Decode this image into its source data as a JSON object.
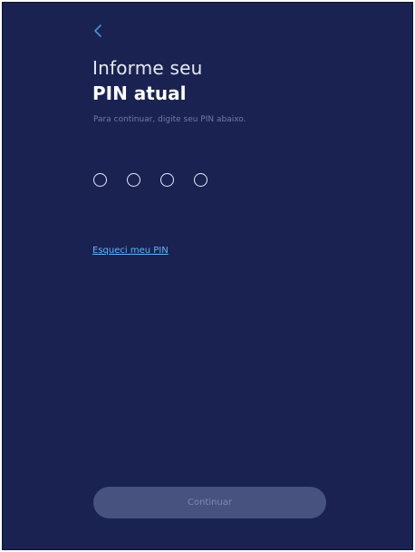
{
  "colors": {
    "background": "#1a2251",
    "accent": "#5fb4ff",
    "button_disabled": "#47527e"
  },
  "header": {
    "back_icon": "chevron-left-icon",
    "title_line1": "Informe seu",
    "title_line2": "PIN atual",
    "subtitle": "Para continuar, digite seu PIN abaixo."
  },
  "pin": {
    "digits_entered": 0,
    "length": 4
  },
  "forgot_pin_link": "Esqueci meu PIN",
  "continue_button": {
    "label": "Continuar",
    "disabled": true
  }
}
